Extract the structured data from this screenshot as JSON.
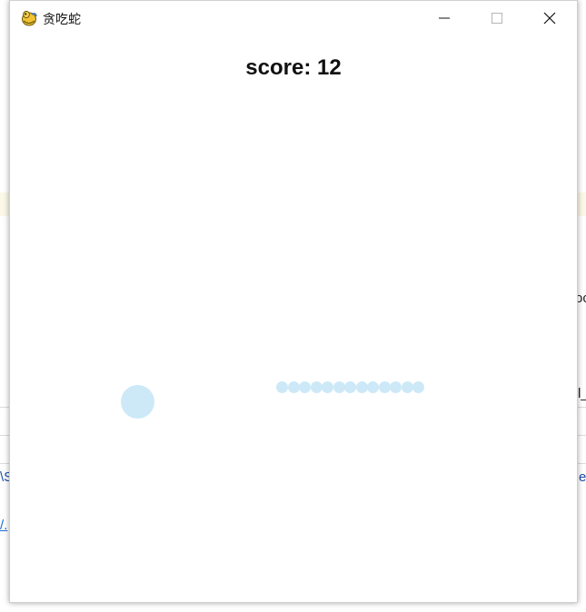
{
  "window": {
    "title": "贪吃蛇",
    "app_icon": "python-snake-icon",
    "controls": {
      "minimize_icon": "minimize-icon",
      "maximize_icon": "maximize-icon",
      "close_icon": "close-icon"
    }
  },
  "game": {
    "score_text": "score: 12",
    "food_color": "#cde9f8",
    "snake_color": "#cde9f8",
    "snake_segment_count": 13
  },
  "background": {
    "fragment_right_1": "oc",
    "fragment_right_2": "l_",
    "fragment_left_1": "\\S",
    "fragment_right_3": "e",
    "fragment_left_2": "/."
  }
}
